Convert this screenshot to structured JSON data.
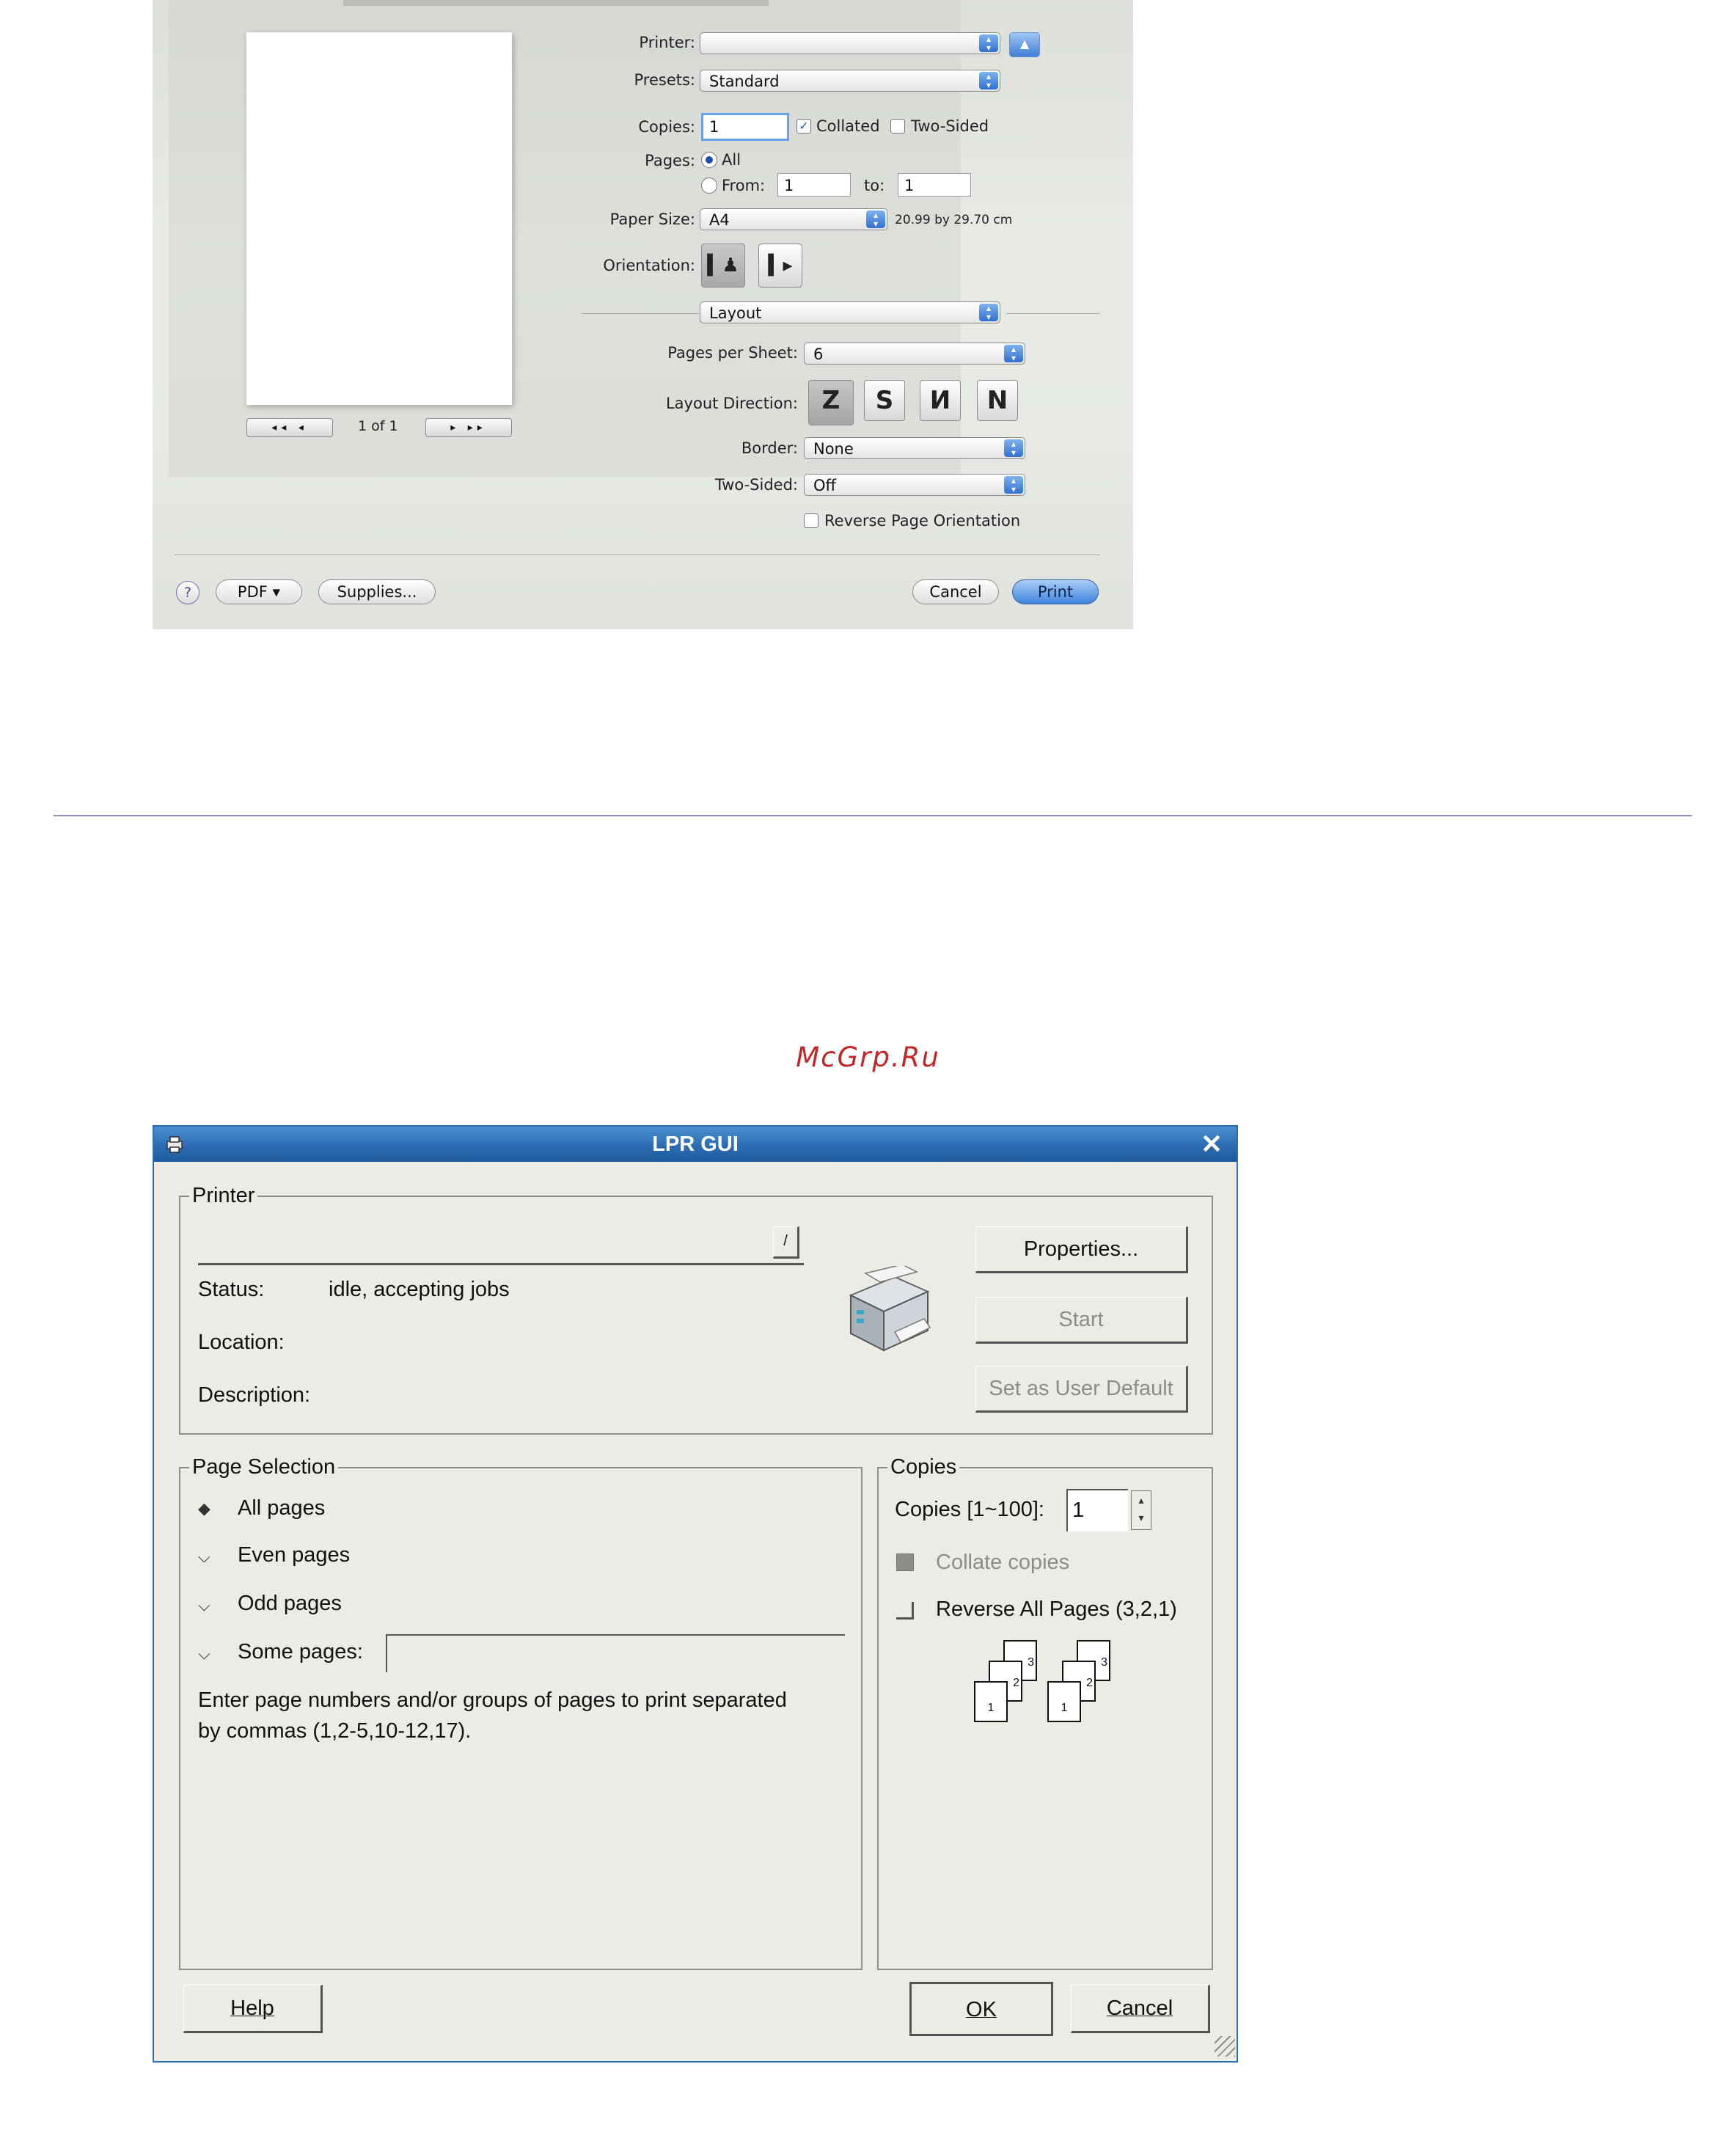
{
  "mac_dialog": {
    "preview_nav": {
      "page_indicator": "1 of 1"
    },
    "printer_label": "Printer:",
    "printer_value": "",
    "presets_label": "Presets:",
    "presets_value": "Standard",
    "copies_label": "Copies:",
    "copies_value": "1",
    "collated_label": "Collated",
    "collated_checked": true,
    "two_sided_label": "Two-Sided",
    "pages_label": "Pages:",
    "pages_all_label": "All",
    "pages_from_label": "From:",
    "pages_from_value": "1",
    "pages_to_label": "to:",
    "pages_to_value": "1",
    "paper_size_label": "Paper Size:",
    "paper_size_value": "A4",
    "paper_size_dims": "20.99 by 29.70 cm",
    "orientation_label": "Orientation:",
    "section_popup": "Layout",
    "pages_per_sheet_label": "Pages per Sheet:",
    "pages_per_sheet_value": "6",
    "layout_direction_label": "Layout Direction:",
    "layout_direction_glyphs": [
      "Z",
      "S",
      "И",
      "N"
    ],
    "border_label": "Border:",
    "border_value": "None",
    "two_sided_popup_label": "Two-Sided:",
    "two_sided_popup_value": "Off",
    "reverse_orientation_label": "Reverse Page Orientation",
    "help_glyph": "?",
    "pdf_button": "PDF ▾",
    "supplies_button": "Supplies...",
    "cancel_button": "Cancel",
    "print_button": "Print"
  },
  "watermark": "McGrp.Ru",
  "lpr_gui": {
    "title": "LPR GUI",
    "close_glyph": "✕",
    "printer_group": {
      "legend": "Printer",
      "status_label": "Status:",
      "status_value": "idle, accepting jobs",
      "location_label": "Location:",
      "description_label": "Description:",
      "properties_button": "Properties...",
      "start_button": "Start",
      "set_default_button": "Set as User Default"
    },
    "page_selection": {
      "legend": "Page Selection",
      "options": [
        "All pages",
        "Even pages",
        "Odd pages",
        "Some pages:"
      ],
      "selected": "All pages",
      "hint_line1": "Enter page numbers and/or groups of pages to print separated",
      "hint_line2": "by commas (1,2-5,10-12,17)."
    },
    "copies_group": {
      "legend": "Copies",
      "copies_label": "Copies [1~100]:",
      "copies_value": "1",
      "collate_label": "Collate copies",
      "reverse_label": "Reverse All Pages (3,2,1)",
      "stack_numbers": [
        "3",
        "2",
        "1"
      ]
    },
    "help_button": "Help",
    "ok_button": "OK",
    "cancel_button": "Cancel"
  }
}
